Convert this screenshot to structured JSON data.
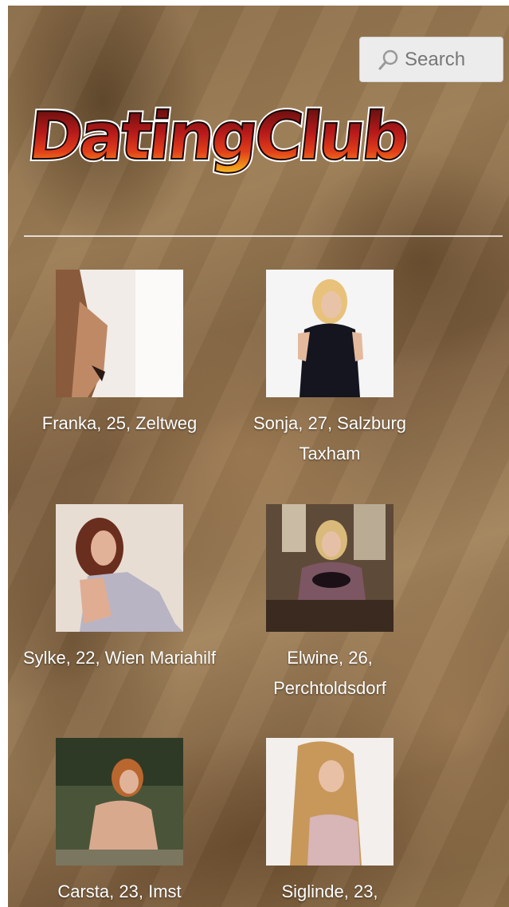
{
  "header": {
    "search_label": "Search",
    "logo_text": "DatingClub"
  },
  "profiles": [
    {
      "label": "Franka, 25, Zeltweg"
    },
    {
      "label": "Sonja, 27, Salzburg Taxham"
    },
    {
      "label": "Sylke, 22, Wien Mariahilf"
    },
    {
      "label": "Elwine, 26, Perchtoldsdorf"
    },
    {
      "label": "Carsta, 23, Imst"
    },
    {
      "label": "Siglinde, 23,"
    }
  ],
  "colors": {
    "logo_top": "#5a1010",
    "logo_mid": "#c41e1e",
    "logo_bottom": "#f3b11b",
    "text": "#ffffff"
  }
}
